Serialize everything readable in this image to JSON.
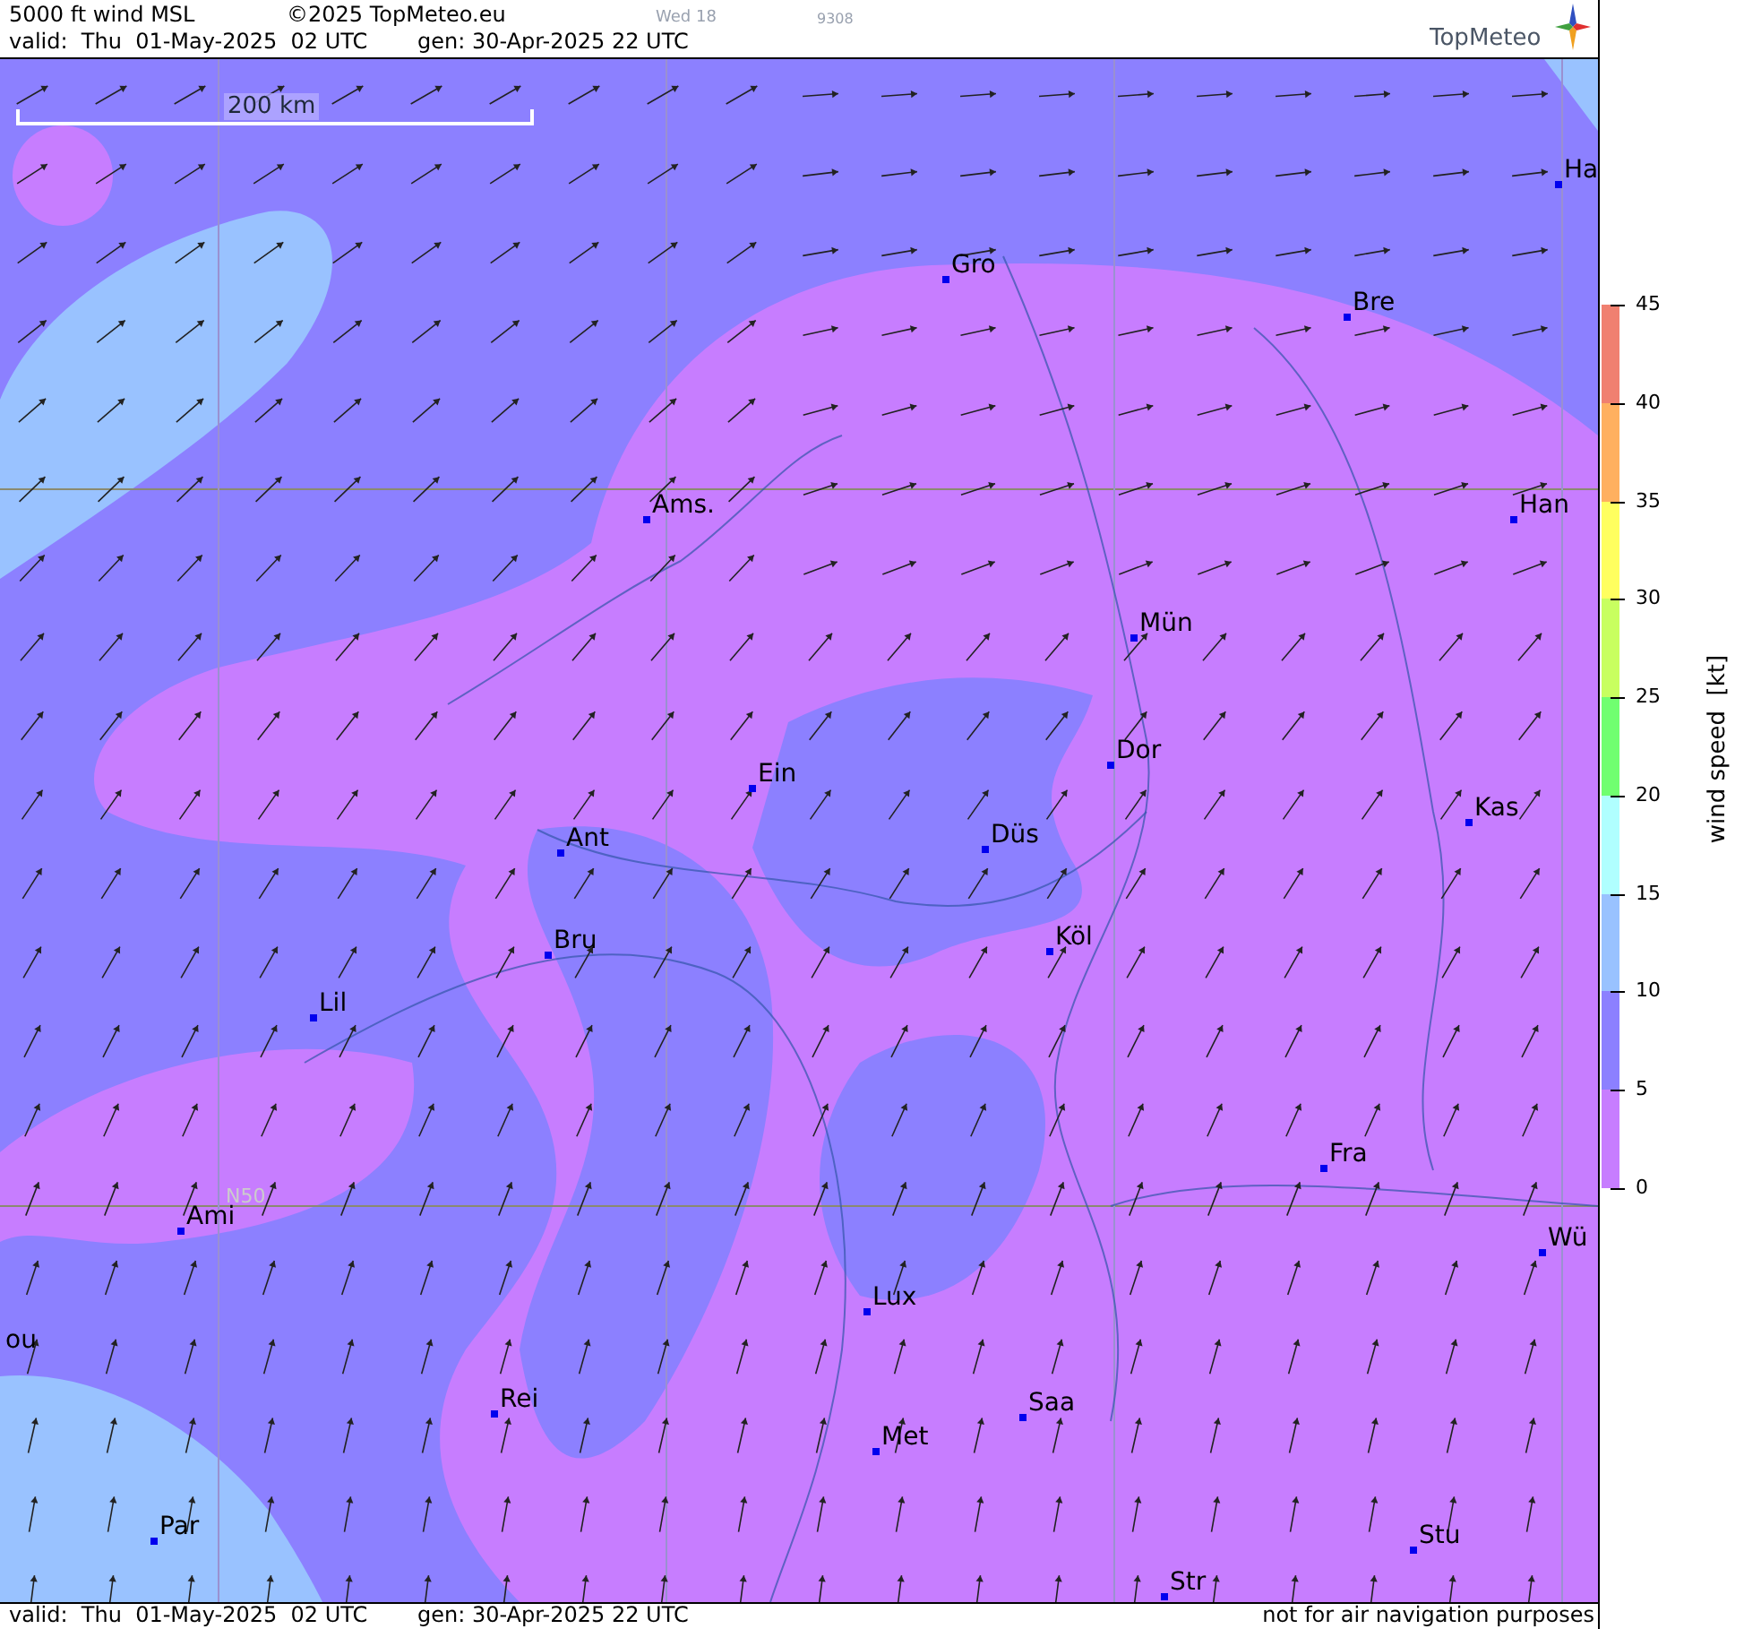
{
  "header": {
    "title": "5000 ft wind MSL",
    "copyright": "©2025 TopMeteo.eu",
    "day": "Wed 18",
    "code": "9308",
    "valid": "valid:  Thu  01-May-2025  02 UTC",
    "gen": "gen: 30-Apr-2025 22 UTC"
  },
  "logo": {
    "text": "TopMeteo"
  },
  "map": {
    "scale_bar": "200 km",
    "latitude_label": "N50",
    "cities": [
      {
        "name": "Ha"
      },
      {
        "name": "Gro"
      },
      {
        "name": "Bre"
      },
      {
        "name": "Ams."
      },
      {
        "name": "Han"
      },
      {
        "name": "Mün"
      },
      {
        "name": "Dor"
      },
      {
        "name": "Ein"
      },
      {
        "name": "Kas"
      },
      {
        "name": "Ant"
      },
      {
        "name": "Düs"
      },
      {
        "name": "Bru"
      },
      {
        "name": "Köl"
      },
      {
        "name": "Lil"
      },
      {
        "name": "Fra"
      },
      {
        "name": "Ami"
      },
      {
        "name": "Wü"
      },
      {
        "name": "Lux"
      },
      {
        "name": "ou"
      },
      {
        "name": "Rei"
      },
      {
        "name": "Saa"
      },
      {
        "name": "Met"
      },
      {
        "name": "Par"
      },
      {
        "name": "Stu"
      },
      {
        "name": "Str"
      }
    ]
  },
  "legend": {
    "label": "wind speed  [kt]",
    "ticks": [
      "45",
      "40",
      "35",
      "30",
      "25",
      "20",
      "15",
      "10",
      "5",
      "0"
    ],
    "bands": [
      {
        "color": "#f08070"
      },
      {
        "color": "#ffb060"
      },
      {
        "color": "#ffff60"
      },
      {
        "color": "#c8ff60"
      },
      {
        "color": "#70ff70"
      },
      {
        "color": "#b0ffff"
      },
      {
        "color": "#99c2ff"
      },
      {
        "color": "#8c80ff"
      },
      {
        "color": "#c77dff"
      }
    ]
  },
  "footer": {
    "valid": "valid:  Thu  01-May-2025  02 UTC",
    "gen": "gen: 30-Apr-2025 22 UTC",
    "disclaimer": "not for air navigation purposes"
  }
}
